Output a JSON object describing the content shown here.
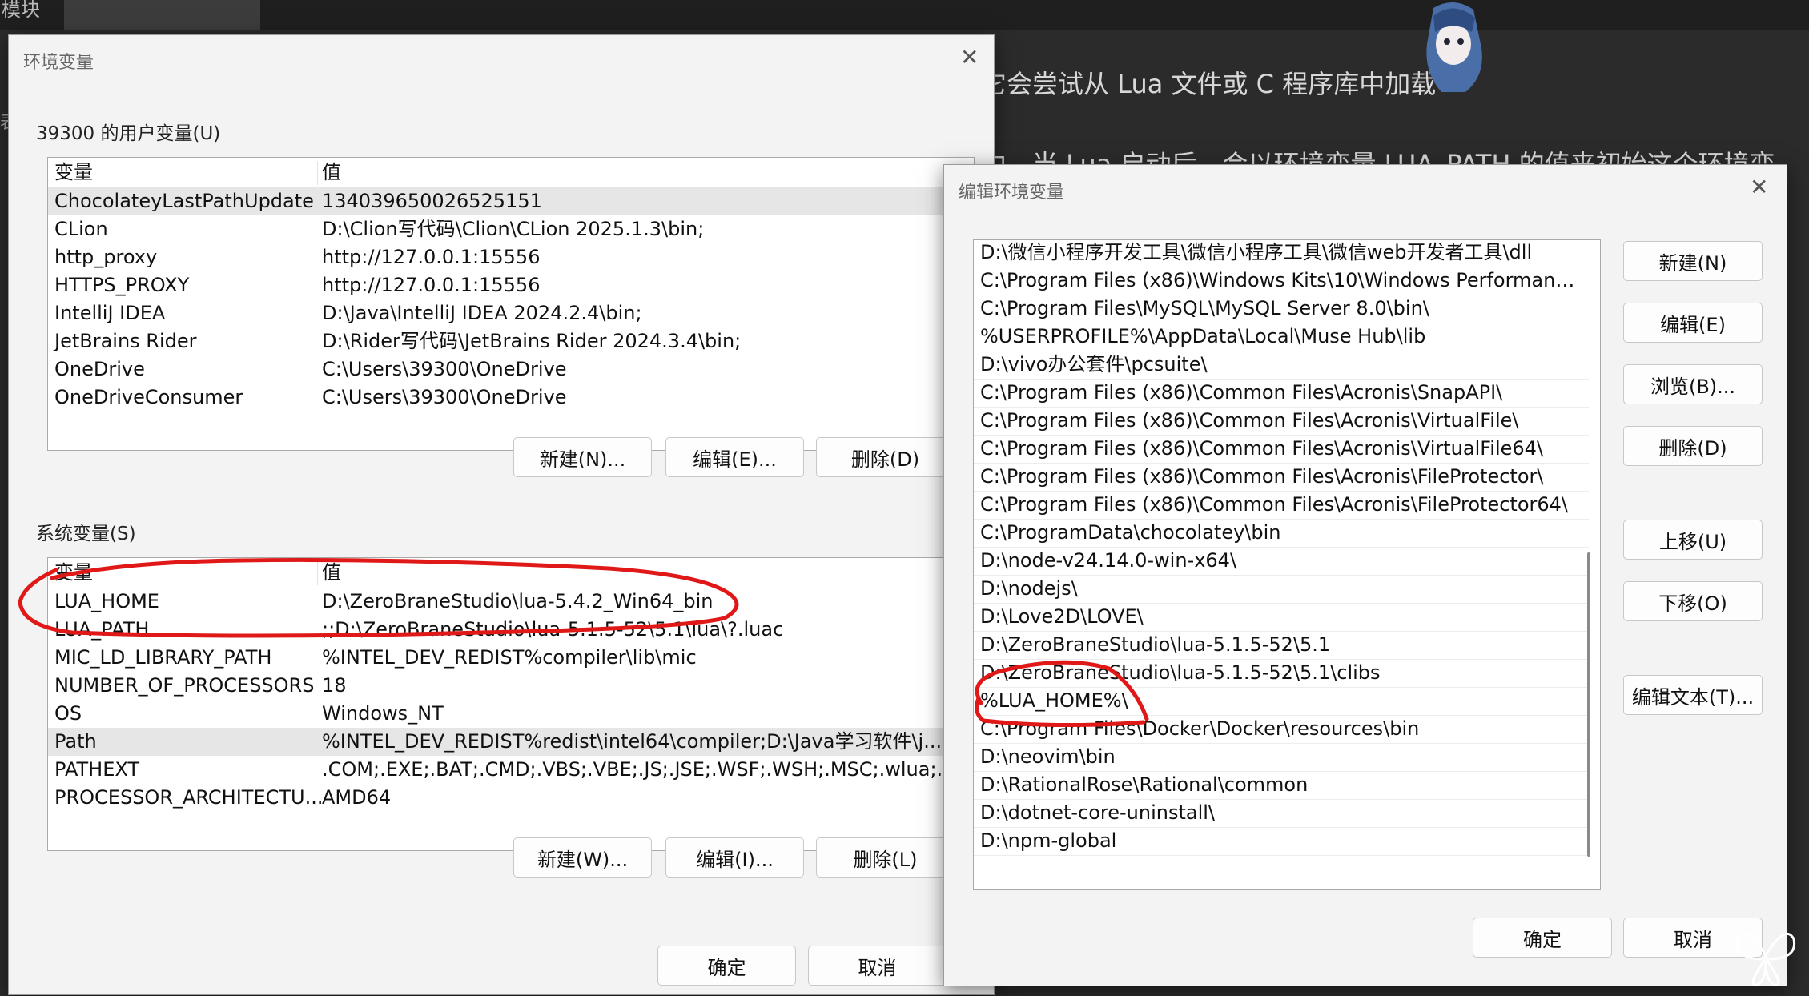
{
  "background": {
    "corner_text": "模块",
    "line1": "它会尝试从 Lua 文件或 C 程序库中加载",
    "line2": "中，当 Lua 启动后，会以环境变量 LUA_PATH 的值来初始这个环境变",
    "left_char": "表"
  },
  "env_dialog": {
    "title": "环境变量",
    "user_group_label": "39300 的用户变量(U)",
    "user_columns": [
      "变量",
      "值"
    ],
    "user_vars": [
      {
        "name": "ChocolateyLastPathUpdate",
        "value": "134039650026525151"
      },
      {
        "name": "CLion",
        "value": "D:\\Clion写代码\\Clion\\CLion 2025.1.3\\bin;"
      },
      {
        "name": "http_proxy",
        "value": "http://127.0.0.1:15556"
      },
      {
        "name": "HTTPS_PROXY",
        "value": "http://127.0.0.1:15556"
      },
      {
        "name": "IntelliJ IDEA",
        "value": "D:\\Java\\IntelliJ IDEA 2024.2.4\\bin;"
      },
      {
        "name": "JetBrains Rider",
        "value": "D:\\Rider写代码\\JetBrains Rider 2024.3.4\\bin;"
      },
      {
        "name": "OneDrive",
        "value": "C:\\Users\\39300\\OneDrive"
      },
      {
        "name": "OneDriveConsumer",
        "value": "C:\\Users\\39300\\OneDrive"
      }
    ],
    "user_buttons": {
      "new": "新建(N)...",
      "edit": "编辑(E)...",
      "delete": "删除(D)"
    },
    "system_group_label": "系统变量(S)",
    "system_columns": [
      "变量",
      "值"
    ],
    "system_vars": [
      {
        "name": "LUA_HOME",
        "value": "D:\\ZeroBraneStudio\\lua-5.4.2_Win64_bin"
      },
      {
        "name": "LUA_PATH",
        "value": ";;D:\\ZeroBraneStudio\\lua-5.1.5-52\\5.1\\lua\\?.luac"
      },
      {
        "name": "MIC_LD_LIBRARY_PATH",
        "value": "%INTEL_DEV_REDIST%compiler\\lib\\mic"
      },
      {
        "name": "NUMBER_OF_PROCESSORS",
        "value": "18"
      },
      {
        "name": "OS",
        "value": "Windows_NT"
      },
      {
        "name": "Path",
        "value": "%INTEL_DEV_REDIST%redist\\intel64\\compiler;D:\\Java学习软件\\j..."
      },
      {
        "name": "PATHEXT",
        "value": ".COM;.EXE;.BAT;.CMD;.VBS;.VBE;.JS;.JSE;.WSF;.WSH;.MSC;.wlua;.l..."
      },
      {
        "name": "PROCESSOR_ARCHITECTU...",
        "value": "AMD64"
      }
    ],
    "system_buttons": {
      "new": "新建(W)...",
      "edit": "编辑(I)...",
      "delete": "删除(L)"
    },
    "ok": "确定",
    "cancel": "取消"
  },
  "edit_dialog": {
    "title": "编辑环境变量",
    "paths": [
      "D:\\微信小程序开发工具\\微信小程序工具\\微信web开发者工具\\dll",
      "C:\\Program Files (x86)\\Windows Kits\\10\\Windows Performance...",
      "C:\\Program Files\\MySQL\\MySQL Server 8.0\\bin\\",
      "%USERPROFILE%\\AppData\\Local\\Muse Hub\\lib",
      "D:\\vivo办公套件\\pcsuite\\",
      "C:\\Program Files (x86)\\Common Files\\Acronis\\SnapAPI\\",
      "C:\\Program Files (x86)\\Common Files\\Acronis\\VirtualFile\\",
      "C:\\Program Files (x86)\\Common Files\\Acronis\\VirtualFile64\\",
      "C:\\Program Files (x86)\\Common Files\\Acronis\\FileProtector\\",
      "C:\\Program Files (x86)\\Common Files\\Acronis\\FileProtector64\\",
      "C:\\ProgramData\\chocolatey\\bin",
      "D:\\node-v24.14.0-win-x64\\",
      "D:\\nodejs\\",
      "D:\\Love2D\\LOVE\\",
      "D:\\ZeroBraneStudio\\lua-5.1.5-52\\5.1",
      "D:\\ZeroBraneStudio\\lua-5.1.5-52\\5.1\\clibs",
      "%LUA_HOME%\\",
      "C:\\Program Files\\Docker\\Docker\\resources\\bin",
      "D:\\neovim\\bin",
      "D:\\RationalRose\\Rational\\common",
      "D:\\dotnet-core-uninstall\\",
      "D:\\npm-global"
    ],
    "buttons": {
      "new": "新建(N)",
      "edit": "编辑(E)",
      "browse": "浏览(B)...",
      "delete": "删除(D)",
      "move_up": "上移(U)",
      "move_down": "下移(O)",
      "edit_text": "编辑文本(T)..."
    },
    "ok": "确定",
    "cancel": "取消"
  },
  "colors": {
    "annotation_red": "#e01818",
    "dialog_bg": "#f3f3f3",
    "selected_row": "#e6e6e6"
  }
}
